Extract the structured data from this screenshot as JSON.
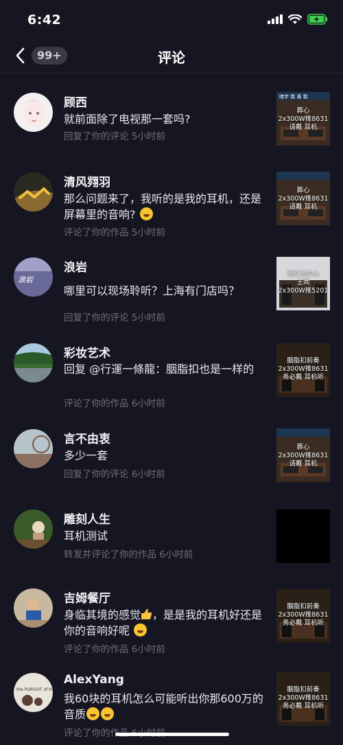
{
  "status_bar": {
    "time": "6:42"
  },
  "nav": {
    "badge": "99+",
    "title": "评论"
  },
  "items": [
    {
      "username": "顾西",
      "comment": "就前面除了电视那一套吗?",
      "meta": "回复了你的评论  5小时前",
      "thumb_lines": [
        "葬心",
        "2x300W推8631",
        "请戴    耳机"
      ]
    },
    {
      "username": "清风翙羽",
      "comment": "那么问题来了，我听的是我的耳机，还是屏幕里的音响?",
      "meta": "评论了你的作品  5小时前",
      "thumb_lines": [
        "葬心",
        "2x300W推8631",
        "请戴    耳机"
      ]
    },
    {
      "username": "浪岩",
      "comment": "哪里可以现场聆听？上海有门店吗？",
      "meta": "回复了你的评论  5小时前",
      "thumb_lines": [
        "酒红色的心",
        "王闻",
        "2x300W推5201"
      ]
    },
    {
      "username": "彩妆艺术",
      "comment": "回复 @行運一條龍：胭脂扣也是一样的",
      "meta": "评论了你的作品  6小时前",
      "thumb_lines": [
        "胭脂扣前奏",
        "2x300W推8631",
        "务必戴    耳机听"
      ]
    },
    {
      "username": "言不由衷",
      "comment": "多少一套",
      "meta": "回复了你的评论  6小时前",
      "thumb_lines": [
        "葬心",
        "2x300W推8631",
        "请戴    耳机"
      ]
    },
    {
      "username": "雕刻人生",
      "comment": "耳机测试",
      "meta": "转发并评论了你的作品  6小时前",
      "thumb_lines": []
    },
    {
      "username": "吉姆餐厅",
      "comment_parts": [
        "身临其境的感觉",
        "，是是我的耳机好还是你的音响好呢"
      ],
      "meta": "评论了你的作品  6小时前",
      "thumb_lines": [
        "胭脂扣前奏",
        "2x300W推8631",
        "务必戴    耳机听"
      ]
    },
    {
      "username": "AlexYang",
      "comment": "我60块的耳机怎么可能听出你那600万的音质",
      "meta": "评论了你的作品  6小时前",
      "thumb_lines": [
        "胭脂扣前奏",
        "2x300W推8631",
        "务必戴    耳机听"
      ]
    }
  ],
  "icons": {
    "back": "chevron-left-icon",
    "emoji": "laughing-emoji-icon",
    "thumbs_up": "thumbs-up-icon"
  },
  "colors": {
    "background": "#161622",
    "meta_text": "#6f6f7c",
    "badge_bg": "#3a3a44"
  }
}
